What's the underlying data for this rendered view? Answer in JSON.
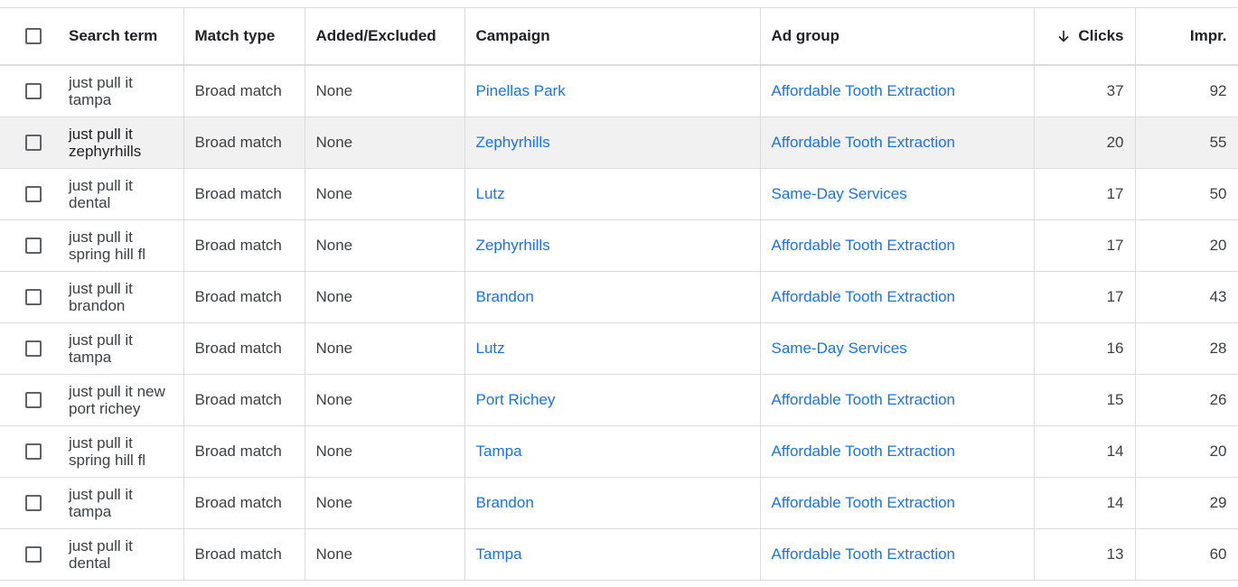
{
  "columns": {
    "search_term": "Search term",
    "match_type": "Match type",
    "added_excluded": "Added/Excluded",
    "campaign": "Campaign",
    "ad_group": "Ad group",
    "clicks": "Clicks",
    "impr": "Impr."
  },
  "sort": {
    "column": "Clicks",
    "direction": "descending",
    "icon": "arrow-down-icon"
  },
  "colors": {
    "link": "#1a73e8",
    "highlight_row": "#f1f1f1",
    "border": "#dadce0"
  },
  "rows": [
    {
      "term": "just pull it tampa",
      "match": "Broad match",
      "added": "None",
      "campaign": "Pinellas Park",
      "adgroup": "Affordable Tooth Extraction",
      "clicks": "37",
      "impr": "92"
    },
    {
      "term": "just pull it zephyrhills",
      "match": "Broad match",
      "added": "None",
      "campaign": "Zephyrhills",
      "adgroup": "Affordable Tooth Extraction",
      "clicks": "20",
      "impr": "55"
    },
    {
      "term": "just pull it dental",
      "match": "Broad match",
      "added": "None",
      "campaign": "Lutz",
      "adgroup": "Same-Day Services",
      "clicks": "17",
      "impr": "50"
    },
    {
      "term": "just pull it spring hill fl",
      "match": "Broad match",
      "added": "None",
      "campaign": "Zephyrhills",
      "adgroup": "Affordable Tooth Extraction",
      "clicks": "17",
      "impr": "20"
    },
    {
      "term": "just pull it brandon",
      "match": "Broad match",
      "added": "None",
      "campaign": "Brandon",
      "adgroup": "Affordable Tooth Extraction",
      "clicks": "17",
      "impr": "43"
    },
    {
      "term": "just pull it tampa",
      "match": "Broad match",
      "added": "None",
      "campaign": "Lutz",
      "adgroup": "Same-Day Services",
      "clicks": "16",
      "impr": "28"
    },
    {
      "term": "just pull it new port richey",
      "match": "Broad match",
      "added": "None",
      "campaign": "Port Richey",
      "adgroup": "Affordable Tooth Extraction",
      "clicks": "15",
      "impr": "26"
    },
    {
      "term": "just pull it spring hill fl",
      "match": "Broad match",
      "added": "None",
      "campaign": "Tampa",
      "adgroup": "Affordable Tooth Extraction",
      "clicks": "14",
      "impr": "20"
    },
    {
      "term": "just pull it tampa",
      "match": "Broad match",
      "added": "None",
      "campaign": "Brandon",
      "adgroup": "Affordable Tooth Extraction",
      "clicks": "14",
      "impr": "29"
    },
    {
      "term": "just pull it dental",
      "match": "Broad match",
      "added": "None",
      "campaign": "Tampa",
      "adgroup": "Affordable Tooth Extraction",
      "clicks": "13",
      "impr": "60"
    }
  ]
}
